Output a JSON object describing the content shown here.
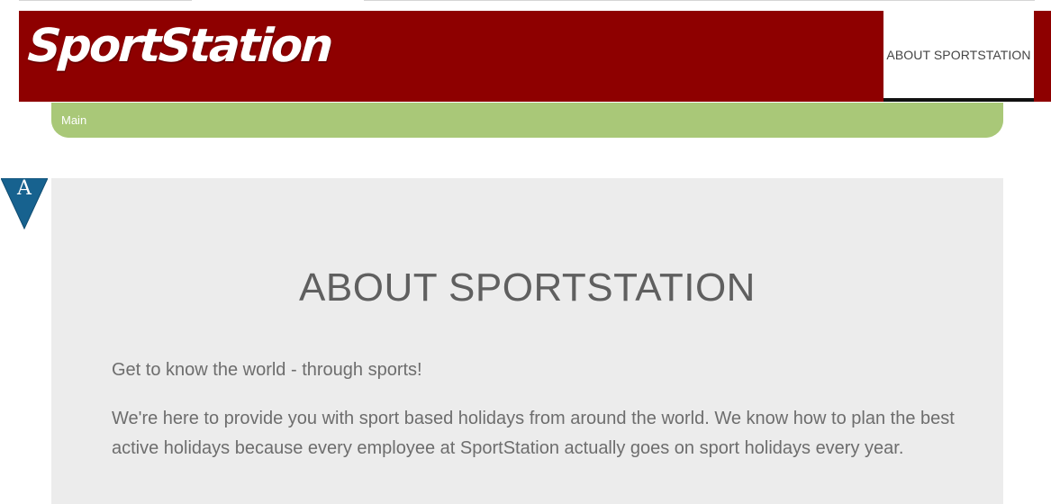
{
  "header": {
    "logo_text": "SportStation",
    "nav_item": "ABOUT SPORTSTATION"
  },
  "breadcrumb": {
    "label": "Main"
  },
  "badge": {
    "letter": "A"
  },
  "content": {
    "title": "ABOUT SPORTSTATION",
    "tagline": "Get to know the world - through sports!",
    "paragraph": "We're here to provide you with sport based holidays from around the world. We know how to plan the best active holidays because every employee at SportStation actually goes on sport holidays every year."
  },
  "colors": {
    "header_bg": "#8e0000",
    "breadcrumb_bg": "#a9c878",
    "panel_bg": "#ececec",
    "badge_bg": "#17628f"
  }
}
